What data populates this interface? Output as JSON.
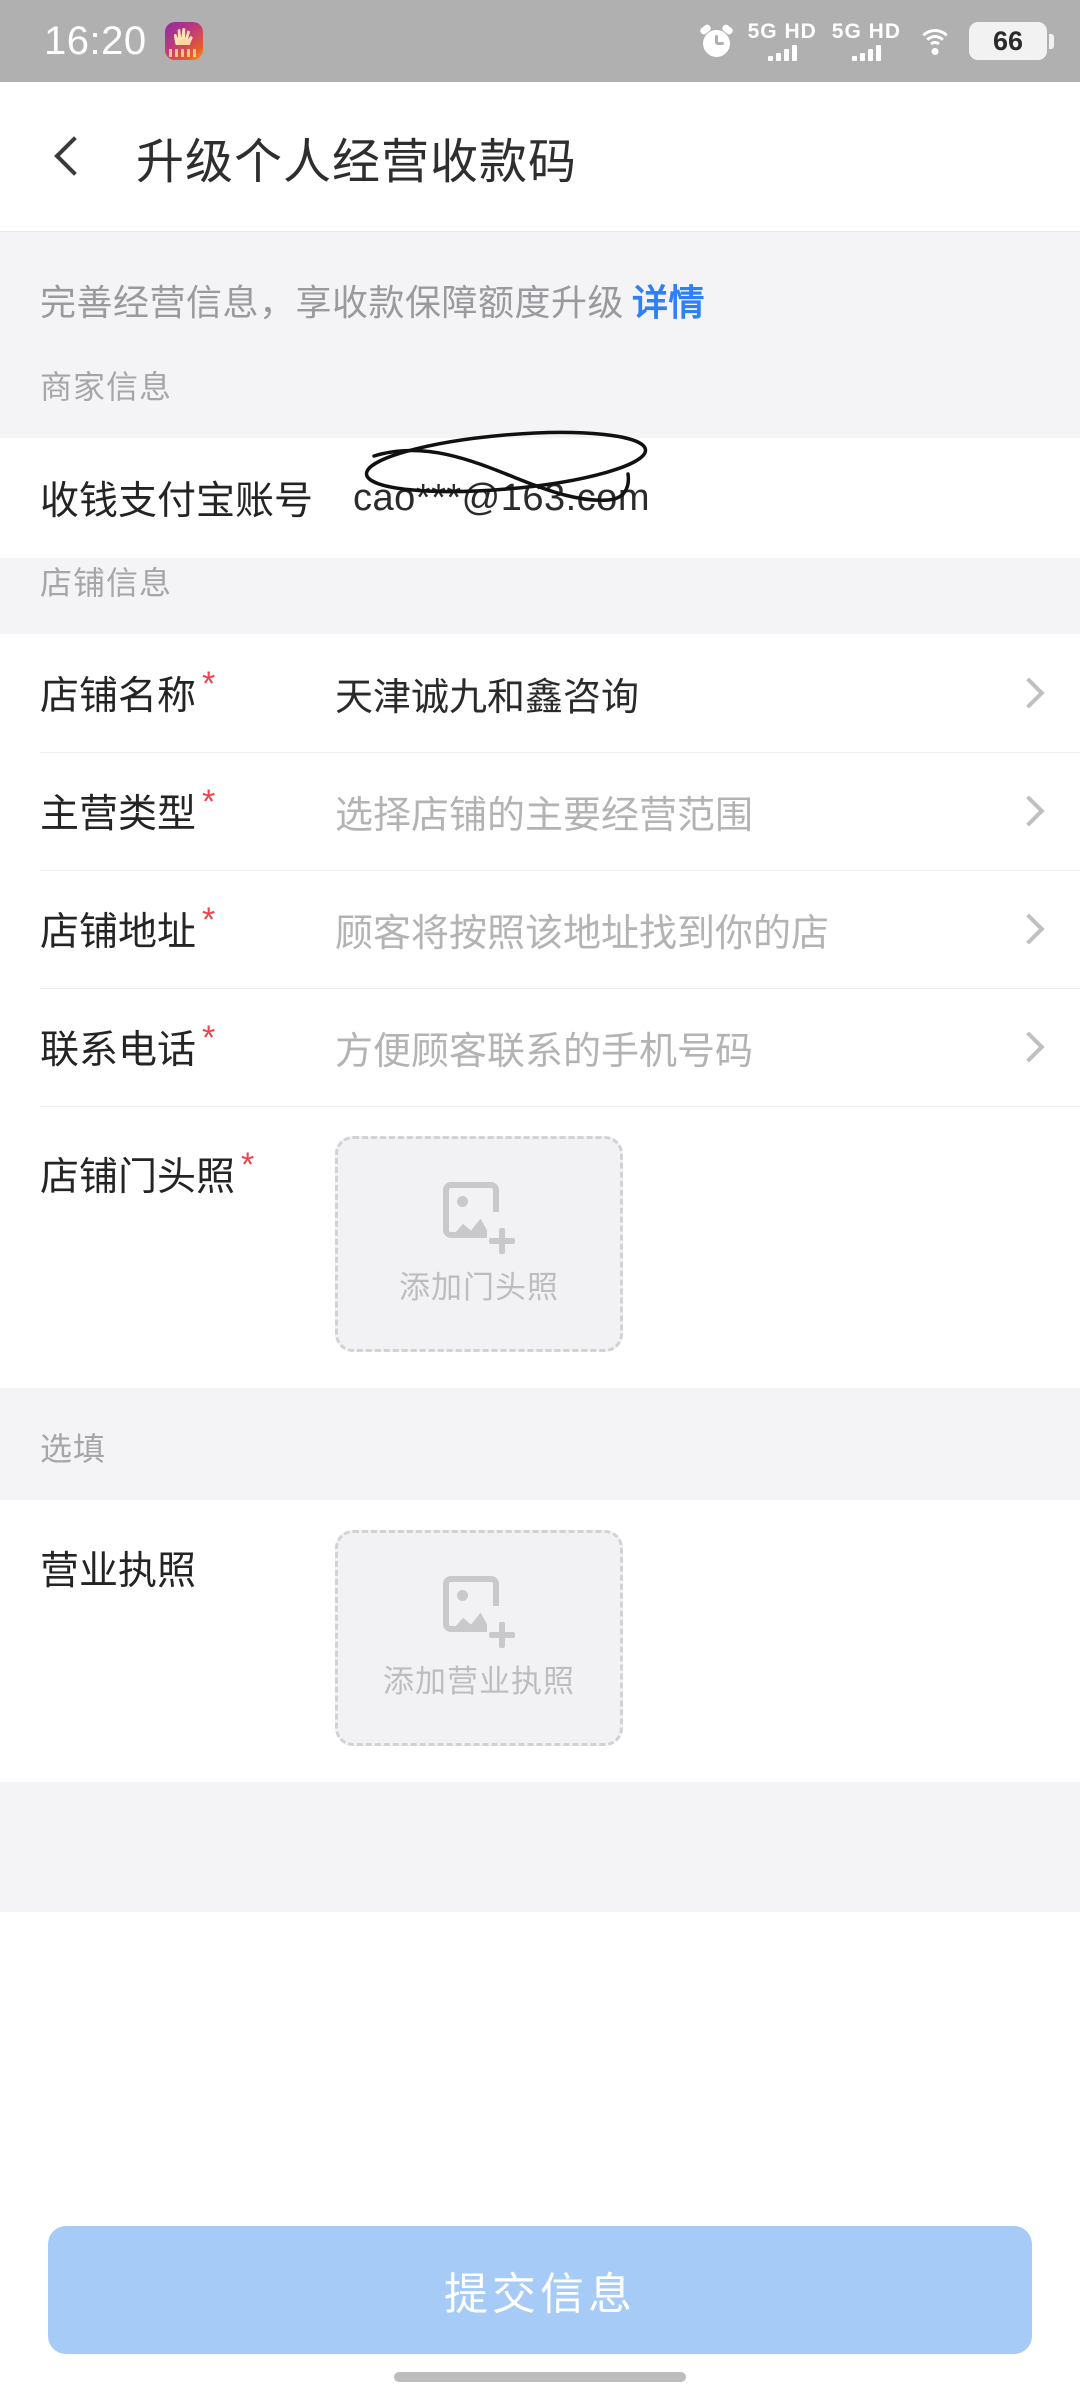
{
  "status_bar": {
    "time": "16:20",
    "app_icon": "firework-app-icon",
    "alarm_icon": "alarm-clock-icon",
    "sim1": {
      "network": "5G",
      "volte": "HD",
      "bars": 4
    },
    "sim2": {
      "network": "5G",
      "volte": "HD",
      "bars": 4
    },
    "wifi_icon": "wifi-icon",
    "battery_level": "66"
  },
  "nav": {
    "back_icon": "chevron-left-icon",
    "title": "升级个人经营收款码"
  },
  "banner": {
    "text": "完善经营信息，享收款保障额度升级",
    "link_label": "详情",
    "link_color": "#2f80f5"
  },
  "merchant_section": {
    "header": "商家信息",
    "rows": [
      {
        "label": "收钱支付宝账号",
        "value": "cao***@163.com",
        "required": false,
        "has_chevron": false,
        "redacted": true
      }
    ]
  },
  "store_section": {
    "header": "店铺信息",
    "rows": [
      {
        "label": "店铺名称",
        "required": true,
        "value": "天津诚九和鑫咨询",
        "is_placeholder": false,
        "chevron_icon": "chevron-right-icon"
      },
      {
        "label": "主营类型",
        "required": true,
        "value": "选择店铺的主要经营范围",
        "is_placeholder": true,
        "chevron_icon": "chevron-right-icon"
      },
      {
        "label": "店铺地址",
        "required": true,
        "value": "顾客将按照该地址找到你的店",
        "is_placeholder": true,
        "chevron_icon": "chevron-right-icon"
      },
      {
        "label": "联系电话",
        "required": true,
        "value": "方便顾客联系的手机号码",
        "is_placeholder": true,
        "chevron_icon": "chevron-right-icon"
      }
    ],
    "upload": {
      "label": "店铺门头照",
      "required": true,
      "button_text": "添加门头照",
      "icon": "add-image-icon"
    }
  },
  "optional_section": {
    "header": "选填",
    "upload": {
      "label": "营业执照",
      "required": false,
      "button_text": "添加营业执照",
      "icon": "add-image-icon"
    }
  },
  "footer": {
    "submit_label": "提交信息",
    "submit_color": "#a6cbf7"
  },
  "required_marker": "*",
  "colors": {
    "section_bg": "#f4f4f6",
    "panel_bg": "#ffffff",
    "label": "#242424",
    "placeholder": "#b3b3b3",
    "required_red": "#f0414f",
    "status_bar_bg": "#b0b0b0"
  }
}
